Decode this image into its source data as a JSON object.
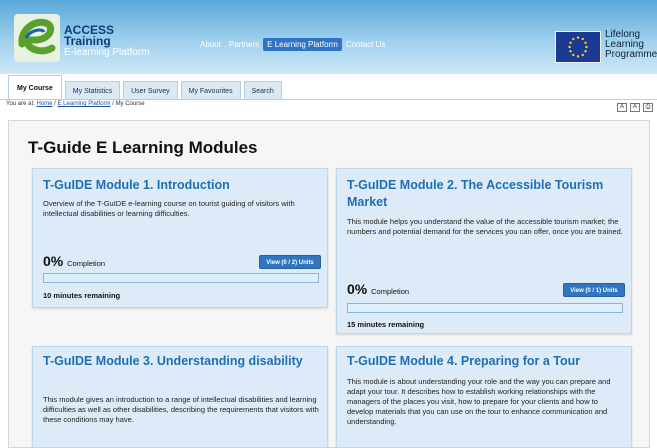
{
  "brand": {
    "line1": "ACCESS",
    "line2": "Training",
    "line3": "E-learning Platform"
  },
  "topnav": [
    {
      "label": "About",
      "active": false
    },
    {
      "label": "Partners",
      "active": false
    },
    {
      "label": "E Learning Platform",
      "active": true
    },
    {
      "label": "Contact Us",
      "active": false
    }
  ],
  "llp": {
    "line1": "Lifelong",
    "line2": "Learning",
    "line3": "Programme"
  },
  "tabs": [
    {
      "label": "My Course",
      "active": true
    },
    {
      "label": "My Statistics",
      "active": false
    },
    {
      "label": "User Survey",
      "active": false
    },
    {
      "label": "My Favourites",
      "active": false
    },
    {
      "label": "Search",
      "active": false
    }
  ],
  "breadcrumb": {
    "prefix": "You are at:",
    "home": "Home",
    "sep1": " / ",
    "platform": "E Learning Platform",
    "sep2": " / ",
    "current": "My Course"
  },
  "tools": [
    "A",
    "A",
    "⎙"
  ],
  "page_title": "T-Guide E Learning Modules",
  "modules": [
    {
      "title": "T-GuIDE Module 1. Introduction",
      "description": "Overview of the T-GuIDE e-learning course on tourist guiding of visitors with intellectual disabilities or learning difficulties.",
      "percent": "0%",
      "completion_label": "Completion",
      "progress": 0,
      "button": "View (0 / 2) Units",
      "remaining": "10 minutes remaining"
    },
    {
      "title": "T-GuIDE Module 2. The Accessible Tourism Market",
      "description": "This module helps you understand the value of the accessible tourism market; the numbers and potential demand for the services you can offer, once you are trained.",
      "percent": "0%",
      "completion_label": "Completion",
      "progress": 0,
      "button": "View (0 / 1) Units",
      "remaining": "15 minutes remaining"
    },
    {
      "title": "T-GuIDE Module 3. Understanding disability",
      "description": "This module gives an introduction to a range of intellectual disabilities and learning difficulties as well as other disabilities, describing the requirements that visitors with these conditions may have."
    },
    {
      "title": "T-GuIDE Module 4. Preparing for a Tour",
      "description": "This module is about understanding your role and the way you can prepare and adapt your tour. It describes how to establish working relationships with the managers of the places you visit, how to prepare for your clients and how to develop materials that you can use on the tour to enhance communication and understanding."
    }
  ]
}
